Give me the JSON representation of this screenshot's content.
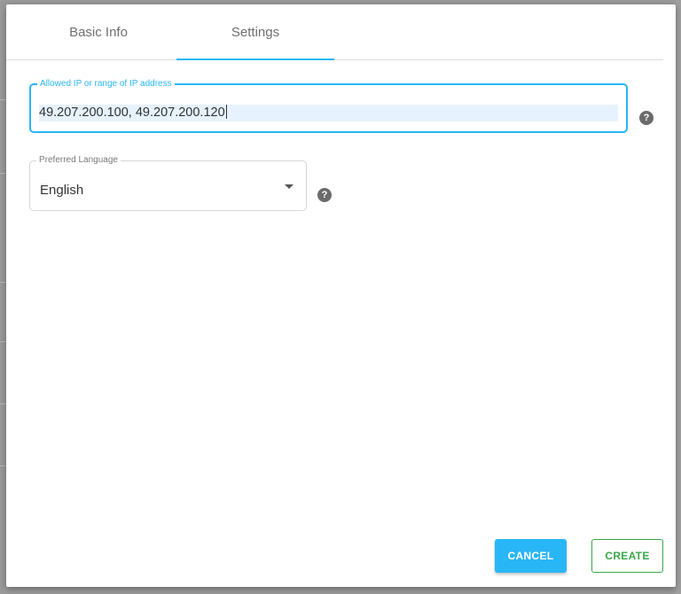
{
  "tabs": [
    {
      "label": "Basic Info"
    },
    {
      "label": "Settings"
    }
  ],
  "ip_field": {
    "label": "Allowed IP or range of IP address",
    "value": "49.207.200.100, 49.207.200.120"
  },
  "language_field": {
    "label": "Preferred Language",
    "value": "English"
  },
  "help_glyph": "?",
  "buttons": {
    "cancel": "CANCEL",
    "create": "CREATE"
  },
  "colors": {
    "accent": "#29b6f6",
    "create_green": "#3aa84a",
    "help_icon": "#6b6b6b"
  },
  "icons": {
    "help": "question-circle-icon",
    "dropdown": "caret-down-icon"
  }
}
